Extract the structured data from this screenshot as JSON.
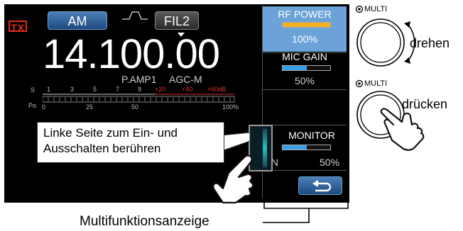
{
  "screen": {
    "tx_badge": "TX",
    "mode_button": "AM",
    "filter_button": "FIL2",
    "frequency": "14.100.00",
    "preamp": "P.AMP1",
    "agc": "AGC-M",
    "meter": {
      "s_label": "S",
      "s_ticks": [
        "1",
        "3",
        "5",
        "7",
        "9"
      ],
      "s_red_ticks": [
        "+20",
        "+40",
        "+60dB"
      ],
      "po_label": "Po",
      "po_ticks": [
        "0",
        "25",
        "50",
        "100%"
      ]
    }
  },
  "multi_panel": {
    "rf_power": {
      "label": "RF POWER",
      "value": "100%",
      "level": 1.0,
      "color": "#f2b01e"
    },
    "mic_gain": {
      "label": "MIC GAIN",
      "value": "50%",
      "level": 0.5,
      "color": "#3aa0e6"
    },
    "monitor": {
      "label": "MONITOR",
      "on_label": "ON",
      "value": "50%",
      "level": 0.5,
      "color": "#3aa0e6"
    },
    "back_icon": "return-arrow-icon"
  },
  "callout": {
    "text_line1": "Linke Seite zum Ein- und",
    "text_line2": "Ausschalten berühren"
  },
  "knobs": {
    "multi_label_1": "MULTI",
    "rotate_text": "drehen",
    "multi_label_2": "MULTI",
    "press_text": "drücken"
  },
  "caption": "Multifunktionsanzeige"
}
